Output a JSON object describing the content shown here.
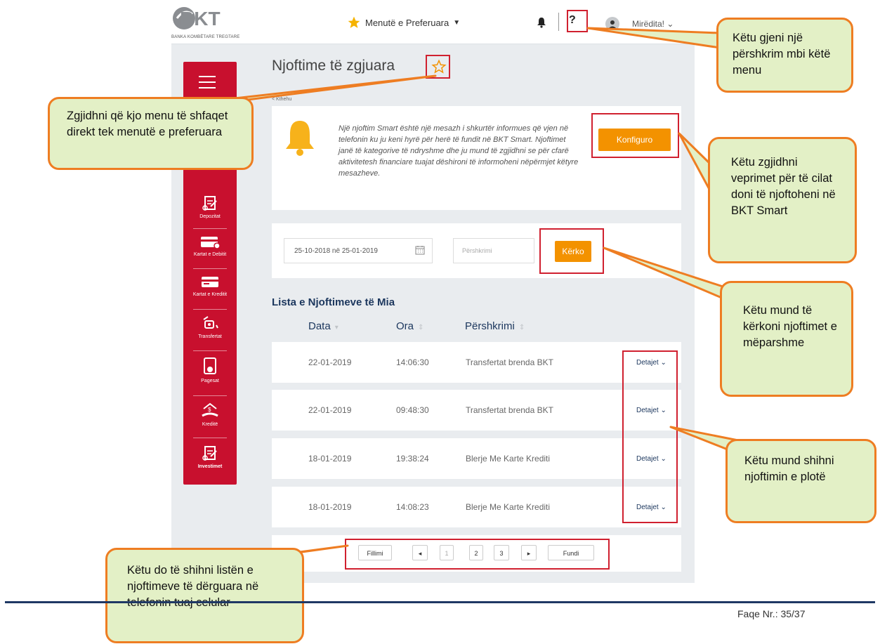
{
  "topbar": {
    "logo_text": "BKT",
    "logo_subtitle": "BANKA KOMBËTARE TREGTARE",
    "favorites_label": "Menutë e Preferuara",
    "help_label": "?",
    "greeting": "Mirëdita!"
  },
  "sidebar": {
    "items": [
      {
        "label": "Depozitat",
        "icon": "deposit-icon"
      },
      {
        "label": "Kartat e Debitit",
        "icon": "debit-card-icon"
      },
      {
        "label": "Kartat e Kreditit",
        "icon": "credit-card-icon"
      },
      {
        "label": "Transfertat",
        "icon": "transfer-icon"
      },
      {
        "label": "Pagesat",
        "icon": "payment-icon"
      },
      {
        "label": "Kreditë",
        "icon": "loan-icon"
      },
      {
        "label": "Investimet",
        "icon": "investment-icon"
      }
    ]
  },
  "page": {
    "title": "Njoftime të zgjuara",
    "back_link": "< Kthehu"
  },
  "info": {
    "text": "Një njoftim Smart është një mesazh i shkurtër informues që vjen në telefonin ku ju keni hyrë për herë të fundit në BKT Smart. Njoftimet janë të kategorive të ndryshme dhe ju mund të zgjidhni se për cfarë aktivitetesh financiare tuajat dëshironi të informoheni nëpërmjet këtyre mesazheve.",
    "configure_button": "Konfiguro"
  },
  "search": {
    "date_range": "25-10-2018 në 25-01-2019",
    "description_placeholder": "Përshkrimi",
    "search_button": "Kërko"
  },
  "list": {
    "title": "Lista e Njoftimeve të Mia",
    "columns": [
      "Data",
      "Ora",
      "Përshkrimi"
    ],
    "details_label": "Detajet",
    "rows": [
      {
        "date": "22-01-2019",
        "time": "14:06:30",
        "description": "Transfertat brenda BKT"
      },
      {
        "date": "22-01-2019",
        "time": "09:48:30",
        "description": "Transfertat brenda BKT"
      },
      {
        "date": "18-01-2019",
        "time": "19:38:24",
        "description": "Blerje Me Karte Krediti"
      },
      {
        "date": "18-01-2019",
        "time": "14:08:23",
        "description": "Blerje Me Karte Krediti"
      }
    ]
  },
  "pagination": {
    "first": "Fillimi",
    "prev": "◂",
    "pages": [
      "1",
      "2",
      "3"
    ],
    "next": "▸",
    "last": "Fundi"
  },
  "callouts": {
    "help": "Këtu gjeni një përshkrim mbi këtë menu",
    "favorite": "Zgjidhni që kjo menu të shfaqet direkt tek menutë e preferuara",
    "configure": "Këtu zgjidhni veprimet për të cilat doni të njoftoheni në BKT Smart",
    "search": "Këtu mund të kërkoni njoftimet e mëparshme",
    "details": "Këtu mund shihni njoftimin e plotë",
    "list": "Këtu do të shihni listën e njoftimeve të dërguara në telefonin tuaj celular"
  },
  "footer": {
    "page_number": "Faqe Nr.: 35/37"
  },
  "colors": {
    "brand_red": "#c8102e",
    "accent_orange": "#f39200",
    "navy": "#1b365d",
    "callout_fill": "#e3f0c6",
    "callout_border": "#ee7d22",
    "highlight_box": "#d0202f"
  }
}
